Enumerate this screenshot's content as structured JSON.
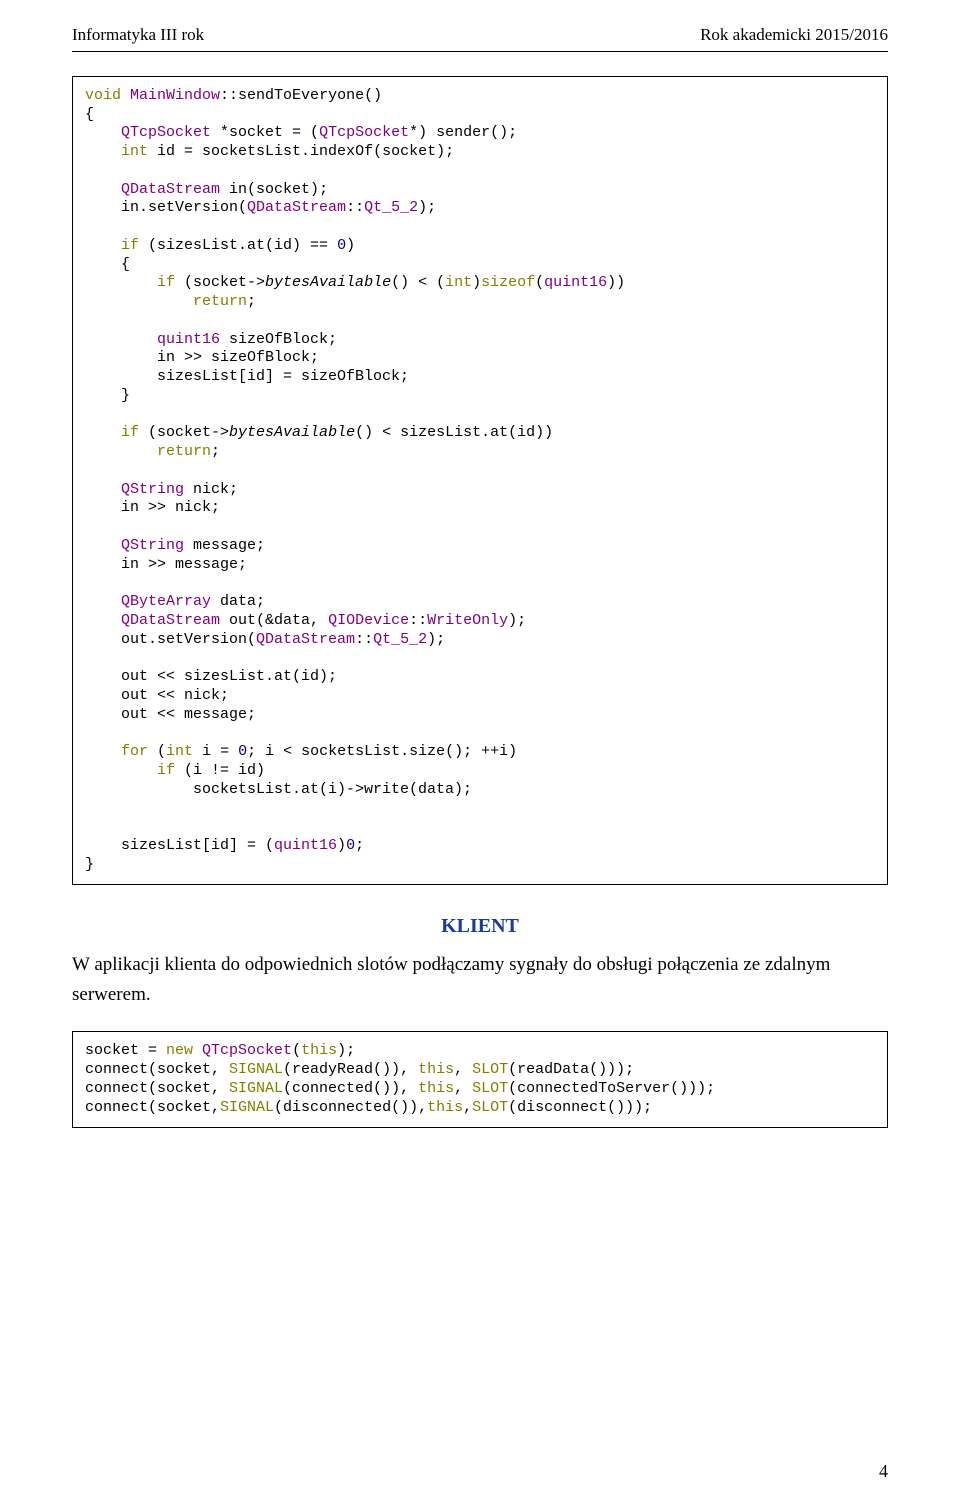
{
  "header": {
    "left": "Informatyka III rok",
    "right": "Rok akademicki 2015/2016"
  },
  "section_title": "KLIENT",
  "paragraph": "W aplikacji klienta do odpowiednich slotów podłączamy sygnały do obsługi połączenia ze zdalnym serwerem.",
  "page_number": "4",
  "chart_data": {
    "type": "table",
    "note": "Document contains two source-code listings in C++/Qt. They are reproduced token-for-token below as data.",
    "listings": [
      {
        "language": "C++",
        "lines": [
          "void MainWindow::sendToEveryone()",
          "{",
          "    QTcpSocket *socket = (QTcpSocket*) sender();",
          "    int id = socketsList.indexOf(socket);",
          "",
          "    QDataStream in(socket);",
          "    in.setVersion(QDataStream::Qt_5_2);",
          "",
          "    if (sizesList.at(id) == 0)",
          "    {",
          "        if (socket->bytesAvailable() < (int)sizeof(quint16))",
          "            return;",
          "",
          "        quint16 sizeOfBlock;",
          "        in >> sizeOfBlock;",
          "        sizesList[id] = sizeOfBlock;",
          "    }",
          "",
          "    if (socket->bytesAvailable() < sizesList.at(id))",
          "        return;",
          "",
          "    QString nick;",
          "    in >> nick;",
          "",
          "    QString message;",
          "    in >> message;",
          "",
          "    QByteArray data;",
          "    QDataStream out(&data, QIODevice::WriteOnly);",
          "    out.setVersion(QDataStream::Qt_5_2);",
          "",
          "    out << sizesList.at(id);",
          "    out << nick;",
          "    out << message;",
          "",
          "    for (int i = 0; i < socketsList.size(); ++i)",
          "        if (i != id)",
          "            socketsList.at(i)->write(data);",
          "",
          "",
          "    sizesList[id] = (quint16)0;",
          "}"
        ]
      },
      {
        "language": "C++",
        "lines": [
          "socket = new QTcpSocket(this);",
          "connect(socket, SIGNAL(readyRead()), this, SLOT(readData()));",
          "connect(socket, SIGNAL(connected()), this, SLOT(connectedToServer()));",
          "connect(socket,SIGNAL(disconnected()),this,SLOT(disconnect()));"
        ]
      }
    ]
  }
}
